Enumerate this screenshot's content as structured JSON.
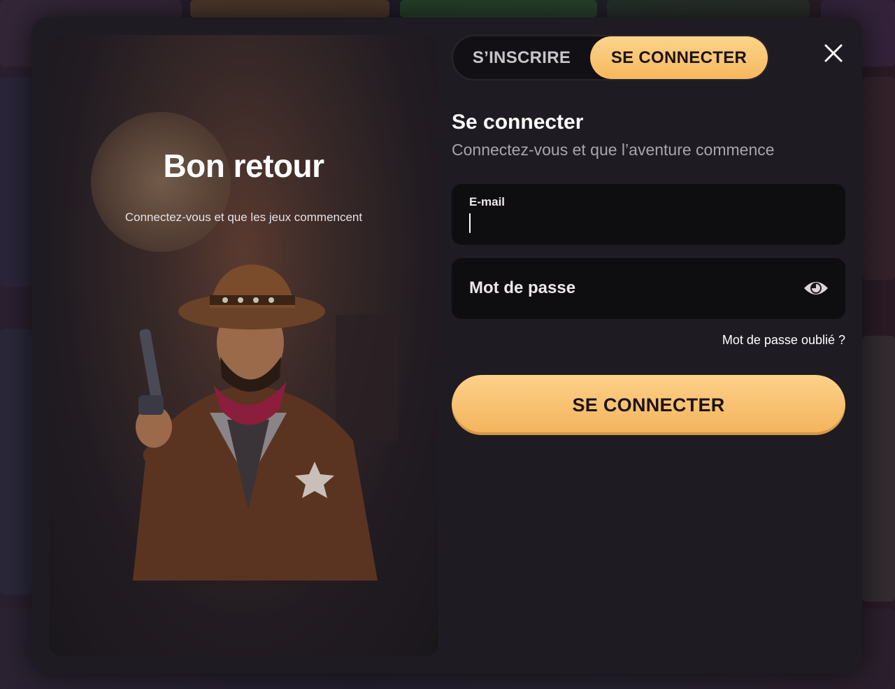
{
  "tabs": {
    "register_label": "S’INSCRIRE",
    "login_label": "SE CONNECTER"
  },
  "hero": {
    "title": "Bon retour",
    "subtitle": "Connectez-vous et que les jeux commencent"
  },
  "form": {
    "title": "Se connecter",
    "subtitle": "Connectez-vous et que l’aventure commence",
    "email_label": "E-mail",
    "email_value": "",
    "password_label": "Mot de passe",
    "forgot_label": "Mot de passe oublié ?",
    "submit_label": "SE CONNECTER"
  },
  "icons": {
    "close": "close-icon",
    "eye": "eye-icon"
  },
  "colors": {
    "accent": "#f6b85f",
    "modal_bg": "#1e1b22",
    "field_bg": "#0e0d10"
  }
}
